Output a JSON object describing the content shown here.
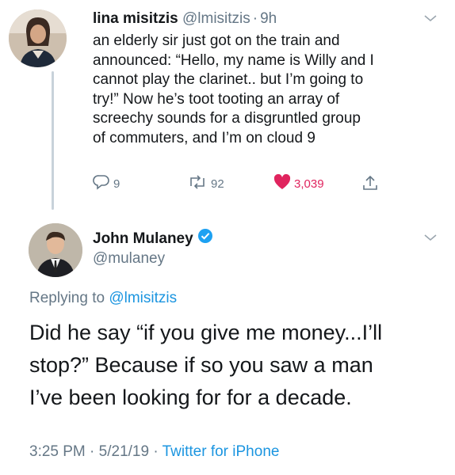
{
  "tweet1": {
    "name": "lina misitzis",
    "handle": "@lmisitzis",
    "sep": "·",
    "time": "9h",
    "lines": [
      "an elderly sir just got on the train and",
      "announced: “Hello, my name is Willy and I",
      "cannot play the clarinet.. but I’m going to",
      "try!” Now he’s toot tooting an array of",
      "screechy sounds for a disgruntled group",
      "of commuters, and I’m on cloud 9"
    ],
    "replies": "9",
    "retweets": "92",
    "likes": "3,039"
  },
  "tweet2": {
    "name": "John Mulaney",
    "handle": "@mulaney",
    "replying_prefix": "Replying to",
    "replying_handle": "@lmisitzis",
    "lines": [
      "Did he say “if you give me money...I’ll",
      "stop?” Because if so you  saw a man",
      "I’ve been looking for for a decade."
    ],
    "time": "3:25 PM",
    "sep1": "·",
    "date": "5/21/19",
    "sep2": "·",
    "client": "Twitter for iPhone"
  },
  "colors": {
    "accent": "#1b95e0",
    "like": "#e0245e",
    "gray": "#657786",
    "text": "#14171a",
    "verified": "#1da1f2"
  },
  "icons": [
    "reply-icon",
    "retweet-icon",
    "heart-icon",
    "share-icon",
    "chevron-down-icon",
    "verified-badge-icon"
  ]
}
